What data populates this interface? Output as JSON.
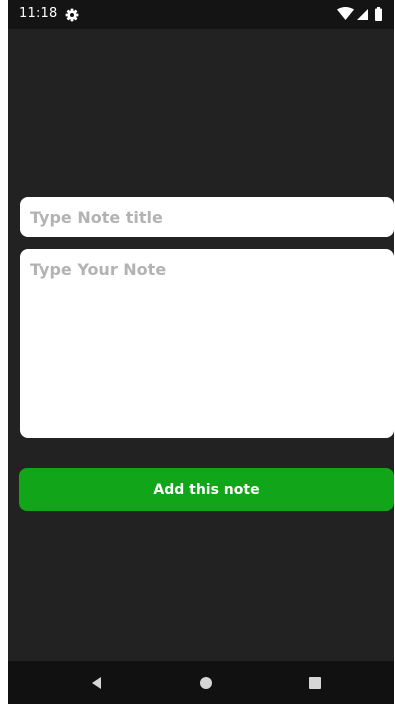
{
  "status_bar": {
    "time": "11:18",
    "settings_icon": "gear-icon",
    "wifi_icon": "wifi-icon",
    "signal_icon": "cell-signal-icon",
    "battery_icon": "battery-icon"
  },
  "form": {
    "title_placeholder": "Type Note title",
    "title_value": "",
    "note_placeholder": "Type Your Note",
    "note_value": "",
    "add_button_label": "Add this note"
  },
  "navigation_bar": {
    "back_icon": "back-triangle-icon",
    "home_icon": "home-circle-icon",
    "recents_icon": "recents-square-icon"
  },
  "colors": {
    "background": "#222222",
    "status_bar": "#141414",
    "nav_bar": "#111111",
    "input_background": "#ffffff",
    "placeholder": "#b3b3b3",
    "accent_button": "#11a619",
    "button_text": "#ffffff"
  }
}
